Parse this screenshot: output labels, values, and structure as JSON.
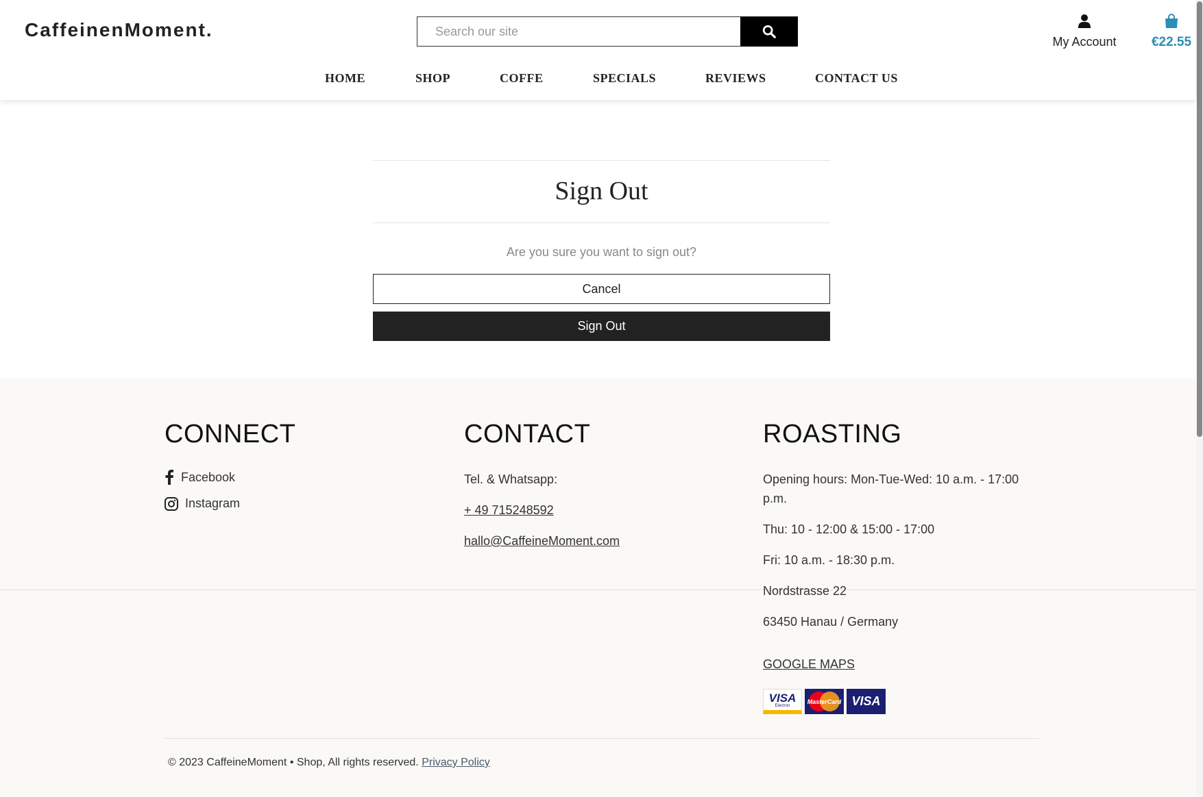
{
  "header": {
    "logo": "CaffeinenMoment.",
    "search_placeholder": "Search our site",
    "account_label": "My Account",
    "cart_amount": "€22.55",
    "accent_color": "#2a8fb5"
  },
  "nav": {
    "items": [
      {
        "label": "HOME"
      },
      {
        "label": "SHOP"
      },
      {
        "label": "COFFE"
      },
      {
        "label": "SPECIALS"
      },
      {
        "label": "REVIEWS"
      },
      {
        "label": "CONTACT US"
      }
    ]
  },
  "signout": {
    "title": "Sign Out",
    "question": "Are you sure you want to sign out?",
    "cancel_label": "Cancel",
    "confirm_label": "Sign Out"
  },
  "footer": {
    "connect": {
      "heading": "CONNECT",
      "facebook": "Facebook",
      "instagram": "Instagram"
    },
    "contact": {
      "heading": "CONTACT",
      "tel_label": "Tel. & Whatsapp:",
      "phone": "+ 49 715248592",
      "email": "hallo@CaffeineMoment.com"
    },
    "roasting": {
      "heading": "ROASTING",
      "hours_1": "Opening hours: Mon-Tue-Wed: 10 a.m. - 17:00 p.m.",
      "hours_2": "Thu: 10 - 12:00 & 15:00 - 17:00",
      "hours_3": "Fri: 10 a.m. - 18:30 p.m.",
      "street": "Nordstrasse 22",
      "city": "63450 Hanau / Germany",
      "maps_link": "GOOGLE MAPS",
      "card_1": "VISA",
      "card_1_sub": "Electron",
      "card_2": "MasterCard",
      "card_3": "VISA"
    },
    "copyright_text": "© 2023 CaffeineMoment • Shop, All rights reserved.",
    "privacy_link": "Privacy Policy"
  }
}
